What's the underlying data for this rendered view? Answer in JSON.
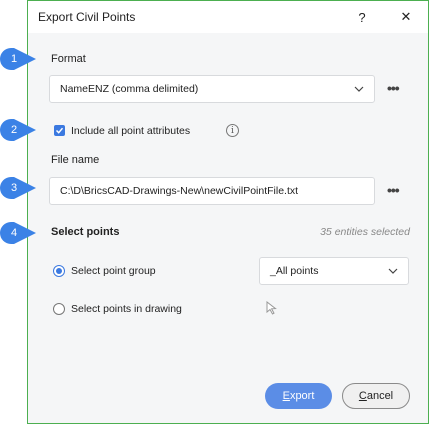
{
  "dialog": {
    "title": "Export Civil Points",
    "help_label": "?",
    "close_label": "✕"
  },
  "format": {
    "label": "Format",
    "value": "NameENZ (comma delimited)",
    "more_label": "•••"
  },
  "attributes": {
    "label": "Include all point attributes",
    "checked": true,
    "info_label": "i"
  },
  "file": {
    "label": "File name",
    "value": "C:\\D\\BricsCAD-Drawings-New\\newCivilPointFile.txt",
    "more_label": "•••"
  },
  "select": {
    "label": "Select points",
    "count_text": "35 entities selected",
    "group_option_label": "Select point group",
    "group_value": "_All points",
    "drawing_option_label": "Select points in drawing",
    "selected_option": "group"
  },
  "buttons": {
    "export_label": "Export",
    "export_mnemonic": "E",
    "cancel_label": "Cancel",
    "cancel_mnemonic": "C"
  },
  "callouts": [
    "1",
    "2",
    "3",
    "4"
  ],
  "colors": {
    "accent": "#3b79e0",
    "callout": "#3b82e6",
    "frame": "#4caf50",
    "primary_button": "#5b8de6"
  }
}
